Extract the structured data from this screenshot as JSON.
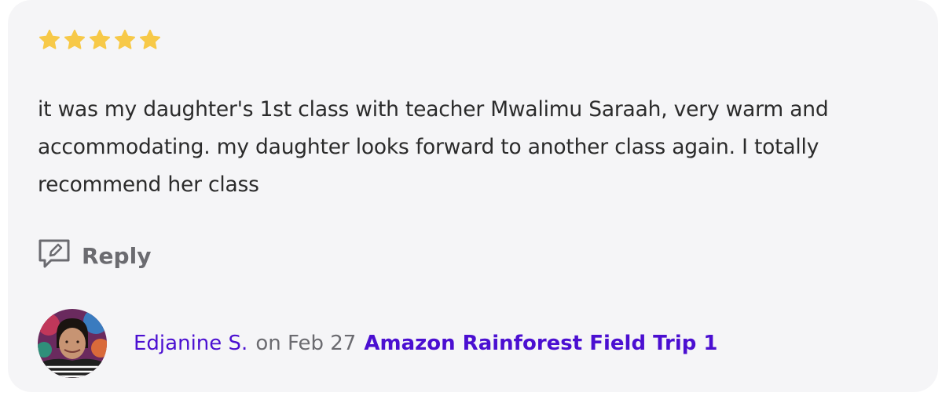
{
  "review": {
    "rating": 5,
    "star_color": "#f7c948",
    "text": "it was my daughter's 1st class with teacher Mwalimu Saraah, very warm and accommodating. my daughter looks forward to another class again. I totally recommend her class"
  },
  "reply": {
    "label": "Reply",
    "icon": "reply-chat-icon"
  },
  "reviewer": {
    "name": "Edjanine S.",
    "date_text": "on Feb 27",
    "class_title": "Amazon Rainforest Field Trip 1",
    "link_color": "#4b0fd1"
  }
}
